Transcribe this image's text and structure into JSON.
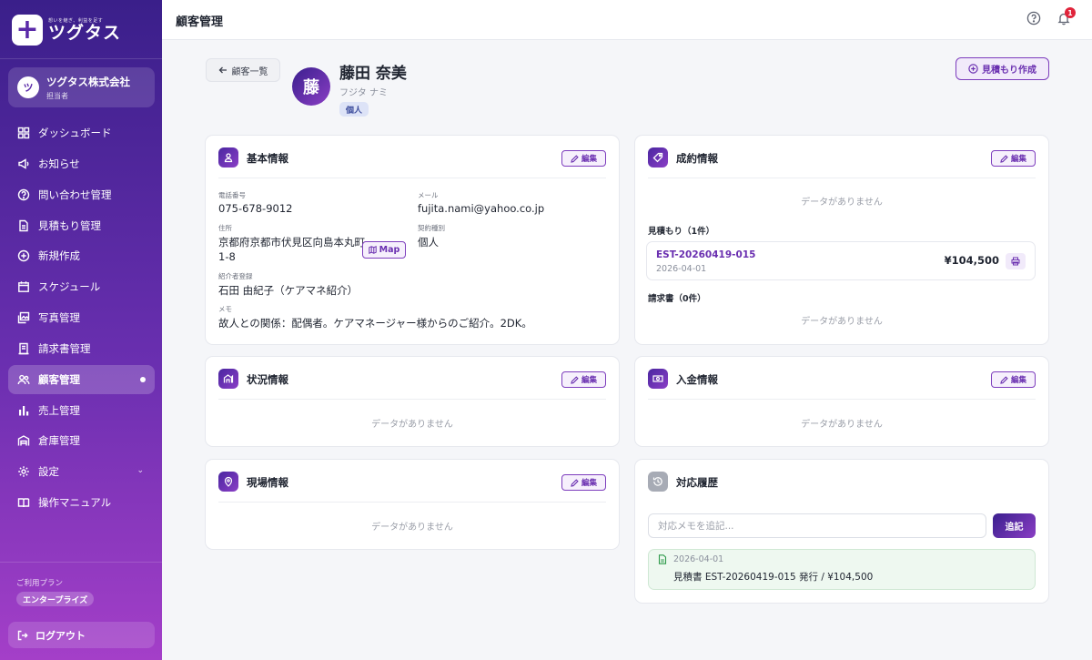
{
  "brand": {
    "tagline": "想いを継ぎ、利益を足す",
    "name": "ツグタス"
  },
  "company": {
    "avatar": "ツ",
    "name": "ツグタス株式会社",
    "role": "担当者"
  },
  "nav": [
    {
      "label": "ダッシュボード",
      "icon": "dashboard-icon"
    },
    {
      "label": "お知らせ",
      "icon": "megaphone-icon"
    },
    {
      "label": "問い合わせ管理",
      "icon": "question-icon"
    },
    {
      "label": "見積もり管理",
      "icon": "document-icon"
    },
    {
      "label": "新規作成",
      "icon": "plus-circle-icon"
    },
    {
      "label": "スケジュール",
      "icon": "calendar-icon"
    },
    {
      "label": "写真管理",
      "icon": "photo-icon"
    },
    {
      "label": "請求書管理",
      "icon": "invoice-icon"
    },
    {
      "label": "顧客管理",
      "icon": "users-icon",
      "active": true
    },
    {
      "label": "売上管理",
      "icon": "bar-chart-icon"
    },
    {
      "label": "倉庫管理",
      "icon": "warehouse-icon"
    },
    {
      "label": "設定",
      "icon": "gear-icon",
      "chevron": "⌄"
    },
    {
      "label": "操作マニュアル",
      "icon": "book-icon"
    }
  ],
  "plan": {
    "label": "ご利用プラン",
    "value": "エンタープライズ"
  },
  "logout": "ログアウト",
  "topbar": {
    "title": "顧客管理",
    "notification_count": "1"
  },
  "header": {
    "back_label": "顧客一覧",
    "avatar": "藤",
    "name": "藤田 奈美",
    "kana": "フジタ ナミ",
    "type": "個人",
    "quote_button": "見積もり作成"
  },
  "edit_label": "編集",
  "empty_text": "データがありません",
  "basic": {
    "title": "基本情報",
    "phone_label": "電話番号",
    "phone": "075-678-9012",
    "email_label": "メール",
    "email": "fujita.nami@yahoo.co.jp",
    "address_label": "住所",
    "address_line1": "京都府京都市伏見区向島本丸町",
    "address_line2": "1-8",
    "map_label": "Map",
    "contract_label": "契約種別",
    "contract": "個人",
    "referrer_label": "紹介者登録",
    "referrer": "石田 由紀子（ケアマネ紹介）",
    "memo_label": "メモ",
    "memo": "故人との関係：配偶者。ケアマネージャー様からのご紹介。2DK。"
  },
  "contract": {
    "title": "成約情報",
    "estimates_label": "見積もり（1件）",
    "estimate": {
      "id": "EST-20260419-015",
      "date": "2026-04-01",
      "amount": "¥104,500"
    },
    "invoices_label": "請求書（0件）"
  },
  "status": {
    "title": "状況情報"
  },
  "payment": {
    "title": "入金情報"
  },
  "site": {
    "title": "現場情報"
  },
  "history": {
    "title": "対応履歴",
    "placeholder": "対応メモを追記...",
    "add_label": "追記",
    "entry": {
      "date": "2026-04-01",
      "text": "見積書 EST-20260419-015 発行 / ¥104,500"
    }
  },
  "colors": {
    "brand": "#6a2fb0",
    "sidebar_top": "#3a1f8a",
    "sidebar_bottom": "#a43fc8",
    "badge": "#e0243b"
  }
}
